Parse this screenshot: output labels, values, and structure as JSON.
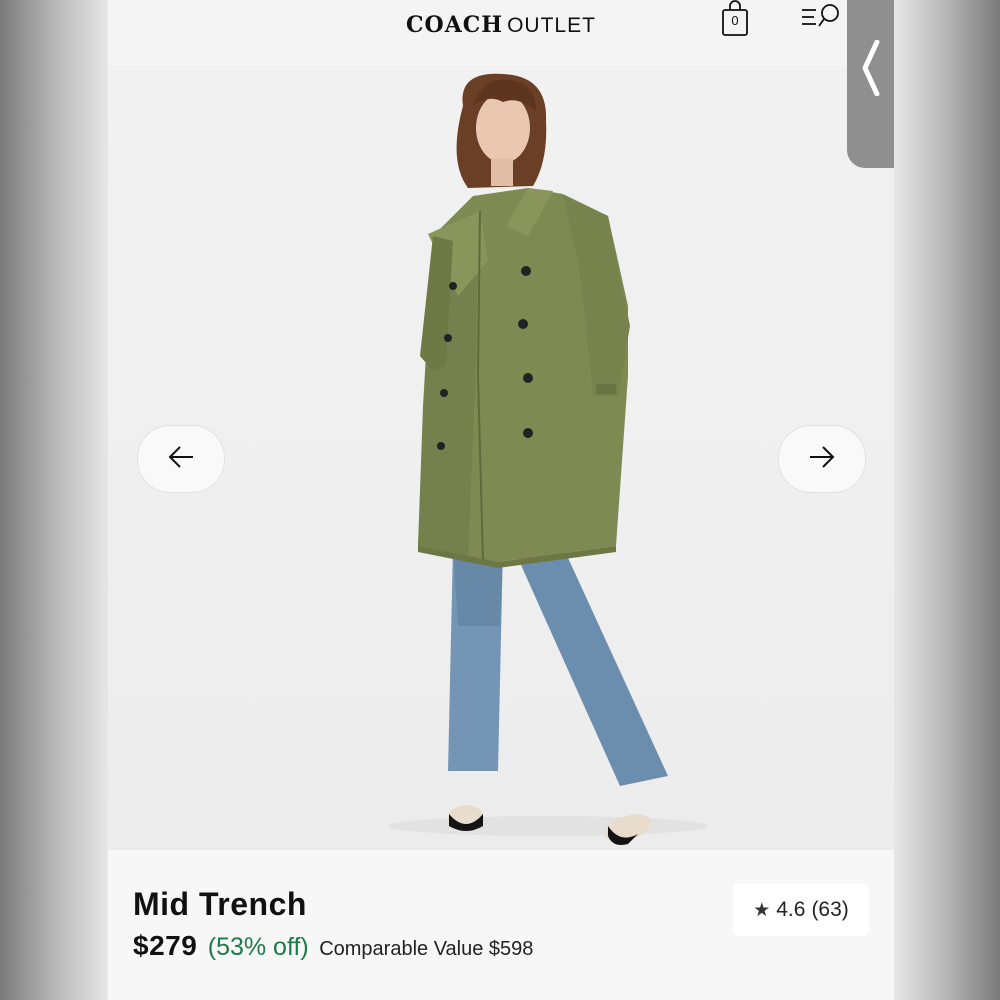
{
  "header": {
    "brand": "COACH",
    "brand_sub": "OUTLET",
    "bag_count": "0",
    "bag_icon": "shopping-bag-icon",
    "menu_icon": "menu-search-icon"
  },
  "gallery": {
    "prev_icon": "arrow-left-icon",
    "next_icon": "arrow-right-icon",
    "image_alt": "Model wearing olive trench coat with jeans"
  },
  "back_tab": {
    "icon": "chevron-left-icon"
  },
  "product": {
    "title": "Mid Trench",
    "price": "$279",
    "discount": "(53% off)",
    "comparable": "Comparable Value $598",
    "rating": "4.6",
    "review_count": "(63)"
  },
  "colors": {
    "discount_green": "#1f7a4a",
    "coat_olive": "#7f8a53",
    "denim": "#6e8fae"
  }
}
